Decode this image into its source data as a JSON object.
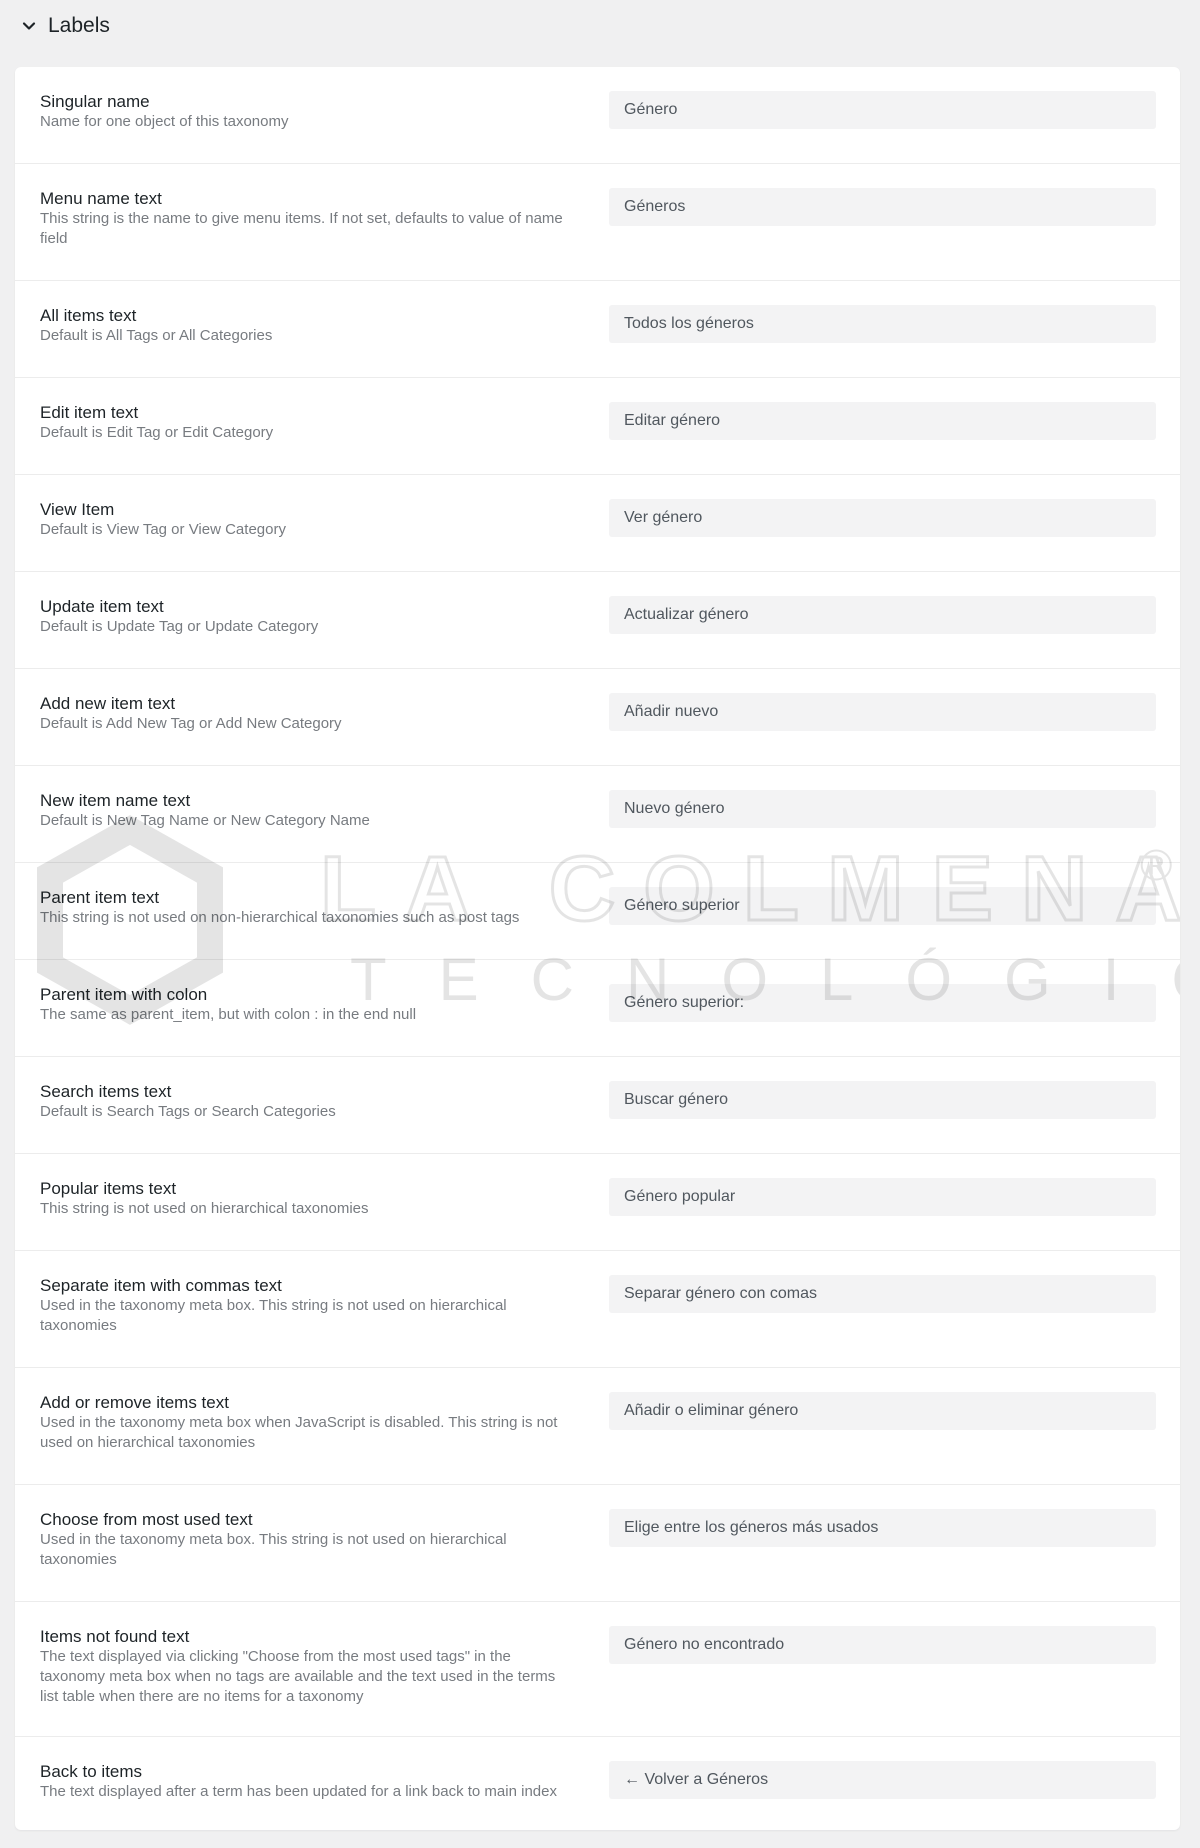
{
  "section": {
    "title": "Labels",
    "collapse_icon": "chevron-down-icon"
  },
  "rows": [
    {
      "label": "Singular name",
      "description": "Name for one object of this taxonomy",
      "value": "Género"
    },
    {
      "label": "Menu name text",
      "description": "This string is the name to give menu items. If not set, defaults to value of name field",
      "value": "Géneros"
    },
    {
      "label": "All items text",
      "description": "Default is All Tags or All Categories",
      "value": "Todos los géneros"
    },
    {
      "label": "Edit item text",
      "description": "Default is Edit Tag or Edit Category",
      "value": "Editar género"
    },
    {
      "label": "View Item",
      "description": "Default is View Tag or View Category",
      "value": "Ver género"
    },
    {
      "label": "Update item text",
      "description": "Default is Update Tag or Update Category",
      "value": "Actualizar género"
    },
    {
      "label": "Add new item text",
      "description": "Default is Add New Tag or Add New Category",
      "value": "Añadir nuevo"
    },
    {
      "label": "New item name text",
      "description": "Default is New Tag Name or New Category Name",
      "value": "Nuevo género"
    },
    {
      "label": "Parent item text",
      "description": "This string is not used on non-hierarchical taxonomies such as post tags",
      "value": "Género superior"
    },
    {
      "label": "Parent item with colon",
      "description": "The same as parent_item, but with colon : in the end null",
      "value": "Género superior:"
    },
    {
      "label": "Search items text",
      "description": "Default is Search Tags or Search Categories",
      "value": "Buscar género"
    },
    {
      "label": "Popular items text",
      "description": "This string is not used on hierarchical taxonomies",
      "value": "Género popular"
    },
    {
      "label": "Separate item with commas text",
      "description": "Used in the taxonomy meta box. This string is not used on hierarchical taxonomies",
      "value": "Separar género con comas"
    },
    {
      "label": "Add or remove items text",
      "description": "Used in the taxonomy meta box when JavaScript is disabled. This string is not used on hierarchical taxonomies",
      "value": "Añadir o eliminar género"
    },
    {
      "label": "Choose from most used text",
      "description": "Used in the taxonomy meta box. This string is not used on hierarchical taxonomies",
      "value": "Elige entre los géneros más usados"
    },
    {
      "label": "Items not found text",
      "description": "The text displayed via clicking \"Choose from the most used tags\" in the taxonomy meta box when no tags are available and the text used in the terms list table when there are no items for a taxonomy",
      "value": "Género no encontrado"
    },
    {
      "label": "Back to items",
      "description": "The text displayed after a term has been updated for a link back to main index",
      "value": "← Volver a Géneros"
    }
  ],
  "watermark": {
    "line1": "LA COLMENA",
    "line2": "TECNOLÓGICA",
    "mark": "®"
  }
}
